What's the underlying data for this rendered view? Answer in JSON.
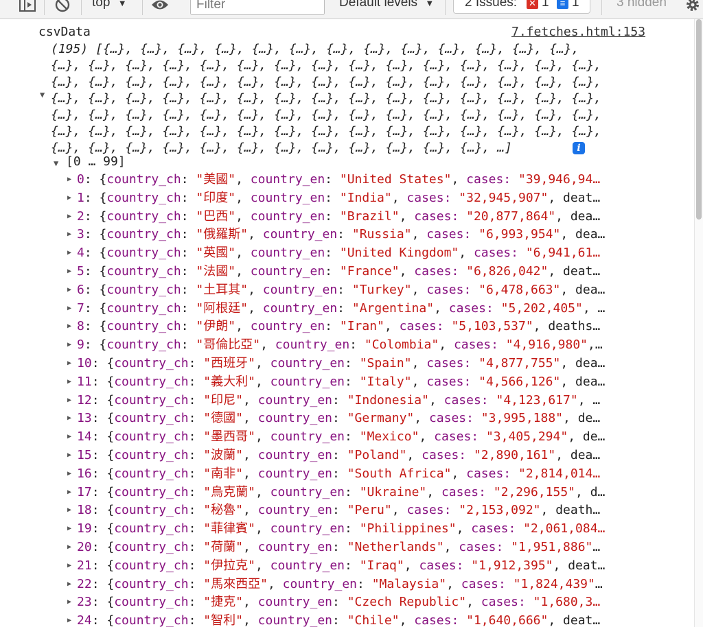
{
  "toolbar": {
    "context": "top",
    "filter_placeholder": "Filter",
    "levels": "Default levels",
    "issues_label": "2 Issues:",
    "errors_count": "1",
    "messages_count": "1",
    "hidden": "3 hidden"
  },
  "console": {
    "variable": "csvData",
    "source": "7.fetches.html:153",
    "array_summary_lines": [
      "(195) [{…}, {…}, {…}, {…}, {…}, {…}, {…}, {…}, {…}, {…}, {…}, {…}, {…},",
      "{…}, {…}, {…}, {…}, {…}, {…}, {…}, {…}, {…}, {…}, {…}, {…}, {…}, {…}, {…},",
      "{…}, {…}, {…}, {…}, {…}, {…}, {…}, {…}, {…}, {…}, {…}, {…}, {…}, {…}, {…},",
      "{…}, {…}, {…}, {…}, {…}, {…}, {…}, {…}, {…}, {…}, {…}, {…}, {…}, {…}, {…},",
      "{…}, {…}, {…}, {…}, {…}, {…}, {…}, {…}, {…}, {…}, {…}, {…}, {…}, {…}, {…},",
      "{…}, {…}, {…}, {…}, {…}, {…}, {…}, {…}, {…}, {…}, {…}, {…}, {…}, {…}, {…},",
      "{…}, {…}, {…}, {…}, {…}, {…}, {…}, {…}, {…}, {…}, {…}, {…}, …]"
    ],
    "group_label": "[0 … 99]",
    "rows": [
      {
        "index": "0",
        "ch": "美國",
        "en": "United States",
        "tail_key": "cases: ",
        "tail_val": "\"39,946,94…"
      },
      {
        "index": "1",
        "ch": "印度",
        "en": "India",
        "tail_key": "cases: ",
        "tail_val": "\"32,945,907\"",
        "tail_rest": ", deat…"
      },
      {
        "index": "2",
        "ch": "巴西",
        "en": "Brazil",
        "tail_key": "cases: ",
        "tail_val": "\"20,877,864\"",
        "tail_rest": ", dea…"
      },
      {
        "index": "3",
        "ch": "俄羅斯",
        "en": "Russia",
        "tail_key": "cases: ",
        "tail_val": "\"6,993,954\"",
        "tail_rest": ", dea…"
      },
      {
        "index": "4",
        "ch": "英國",
        "en": "United Kingdom",
        "tail_key": "cases: ",
        "tail_val": "\"6,941,61…"
      },
      {
        "index": "5",
        "ch": "法國",
        "en": "France",
        "tail_key": "cases: ",
        "tail_val": "\"6,826,042\"",
        "tail_rest": ", deat…"
      },
      {
        "index": "6",
        "ch": "土耳其",
        "en": "Turkey",
        "tail_key": "cases: ",
        "tail_val": "\"6,478,663\"",
        "tail_rest": ", dea…"
      },
      {
        "index": "7",
        "ch": "阿根廷",
        "en": "Argentina",
        "tail_key": "cases: ",
        "tail_val": "\"5,202,405\"",
        "tail_rest": ", …"
      },
      {
        "index": "8",
        "ch": "伊朗",
        "en": "Iran",
        "tail_key": "cases: ",
        "tail_val": "\"5,103,537\"",
        "tail_rest": ", deaths…"
      },
      {
        "index": "9",
        "ch": "哥倫比亞",
        "en": "Colombia",
        "tail_key": "cases: ",
        "tail_val": "\"4,916,980\"",
        "tail_rest": ",…"
      },
      {
        "index": "10",
        "ch": "西班牙",
        "en": "Spain",
        "tail_key": "cases: ",
        "tail_val": "\"4,877,755\"",
        "tail_rest": ", dea…"
      },
      {
        "index": "11",
        "ch": "義大利",
        "en": "Italy",
        "tail_key": "cases: ",
        "tail_val": "\"4,566,126\"",
        "tail_rest": ", dea…"
      },
      {
        "index": "12",
        "ch": "印尼",
        "en": "Indonesia",
        "tail_key": "cases: ",
        "tail_val": "\"4,123,617\"",
        "tail_rest": ", …"
      },
      {
        "index": "13",
        "ch": "德國",
        "en": "Germany",
        "tail_key": "cases: ",
        "tail_val": "\"3,995,188\"",
        "tail_rest": ", de…"
      },
      {
        "index": "14",
        "ch": "墨西哥",
        "en": "Mexico",
        "tail_key": "cases: ",
        "tail_val": "\"3,405,294\"",
        "tail_rest": ", de…"
      },
      {
        "index": "15",
        "ch": "波蘭",
        "en": "Poland",
        "tail_key": "cases: ",
        "tail_val": "\"2,890,161\"",
        "tail_rest": ", dea…"
      },
      {
        "index": "16",
        "ch": "南非",
        "en": "South Africa",
        "tail_key": "cases: ",
        "tail_val": "\"2,814,014…"
      },
      {
        "index": "17",
        "ch": "烏克蘭",
        "en": "Ukraine",
        "tail_key": "cases: ",
        "tail_val": "\"2,296,155\"",
        "tail_rest": ", d…"
      },
      {
        "index": "18",
        "ch": "秘魯",
        "en": "Peru",
        "tail_key": "cases: ",
        "tail_val": "\"2,153,092\"",
        "tail_rest": ", death…"
      },
      {
        "index": "19",
        "ch": "菲律賓",
        "en": "Philippines",
        "tail_key": "cases: ",
        "tail_val": "\"2,061,084…"
      },
      {
        "index": "20",
        "ch": "荷蘭",
        "en": "Netherlands",
        "tail_key": "cases: ",
        "tail_val": "\"1,951,886\"",
        "tail_rest": "…"
      },
      {
        "index": "21",
        "ch": "伊拉克",
        "en": "Iraq",
        "tail_key": "cases: ",
        "tail_val": "\"1,912,395\"",
        "tail_rest": ", deat…"
      },
      {
        "index": "22",
        "ch": "馬來西亞",
        "en": "Malaysia",
        "tail_key": "cases: ",
        "tail_val": "\"1,824,439\"",
        "tail_rest": "…"
      },
      {
        "index": "23",
        "ch": "捷克",
        "en": "Czech Republic",
        "tail_key": "cases: ",
        "tail_val": "\"1,680,3…"
      },
      {
        "index": "24",
        "ch": "智利",
        "en": "Chile",
        "tail_key": "cases: ",
        "tail_val": "\"1,640,666\"",
        "tail_rest": ", deat…"
      }
    ]
  },
  "colors": {
    "key": "#881280",
    "string": "#c41a16",
    "info_badge": "#1a73e8",
    "error_badge": "#d93025"
  }
}
